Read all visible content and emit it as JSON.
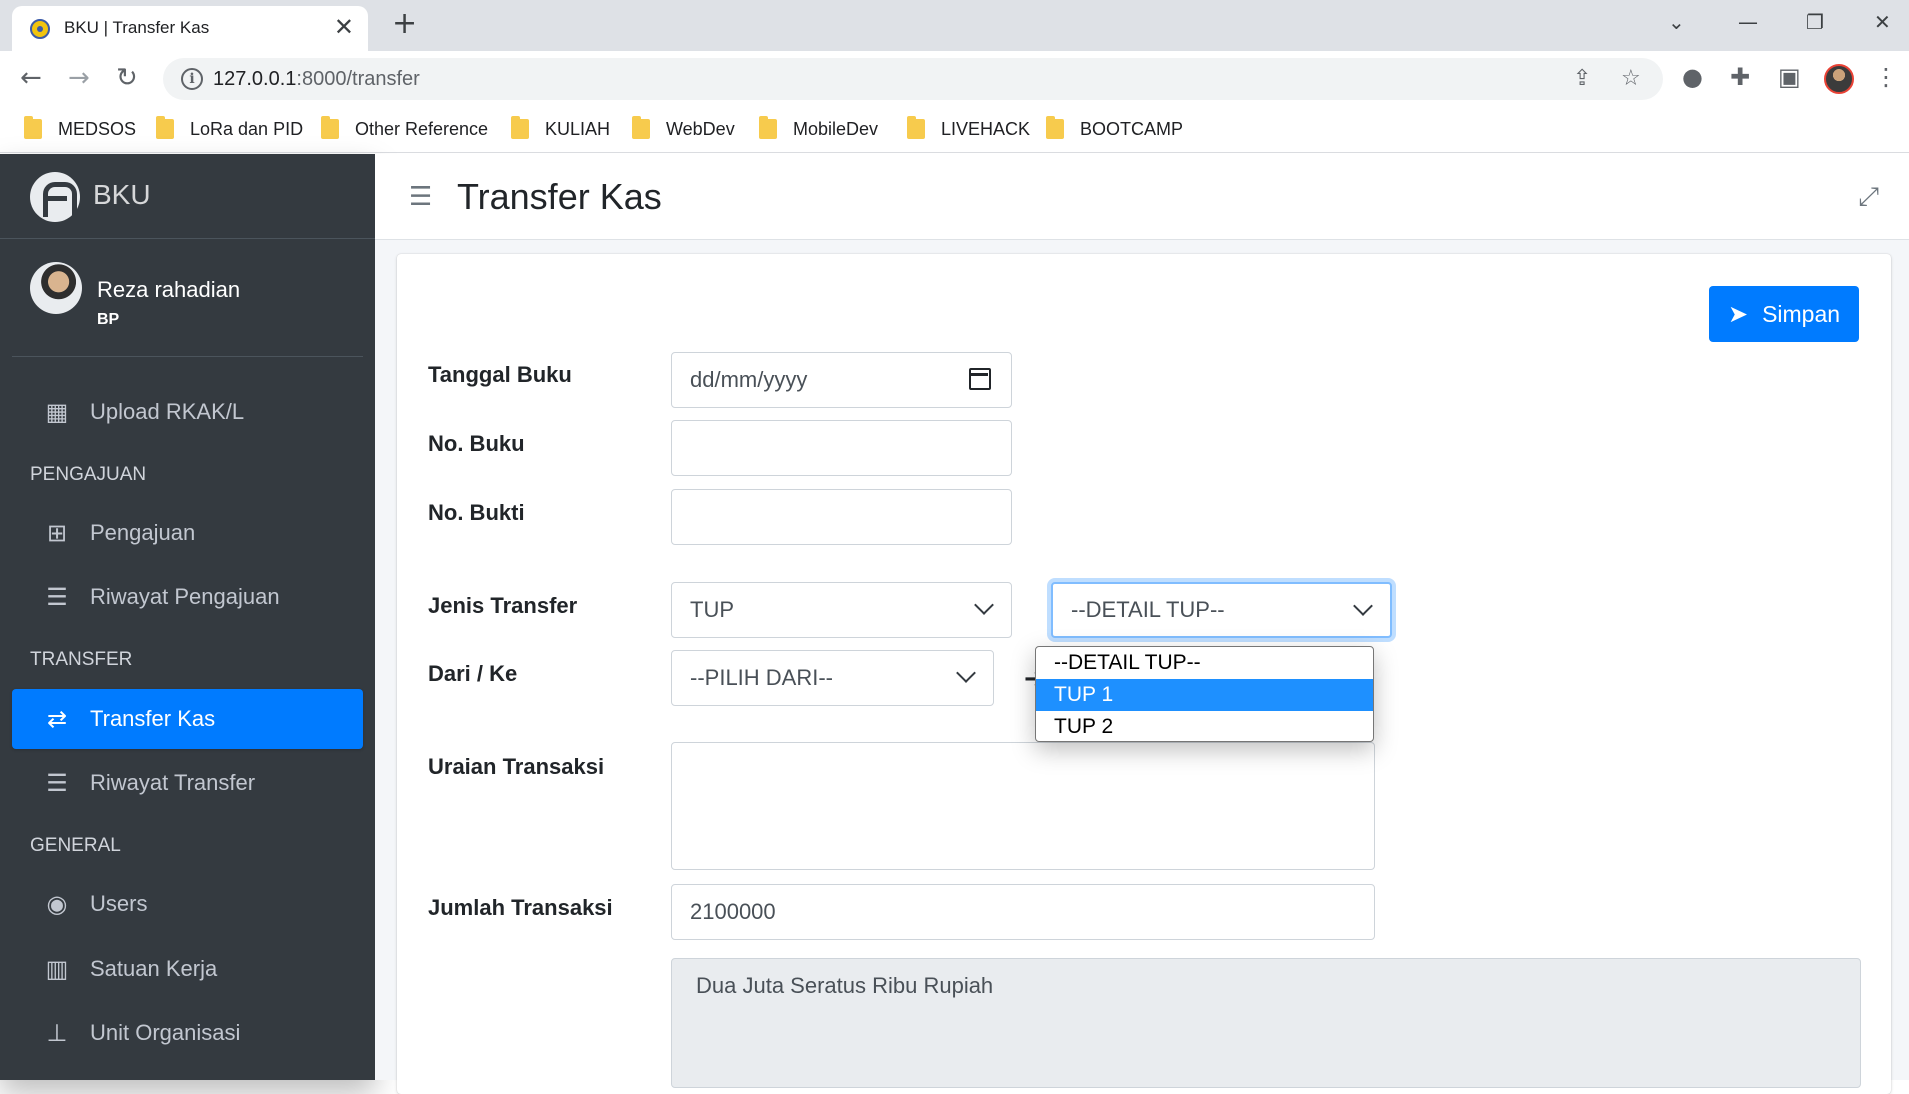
{
  "browser": {
    "tab_title": "BKU | Transfer Kas",
    "url_host": "127.0.0.1",
    "url_rest": ":8000/transfer",
    "bookmarks": [
      "MEDSOS",
      "LoRa dan PID",
      "Other Reference",
      "KULIAH",
      "WebDev",
      "MobileDev",
      "LIVEHACK",
      "BOOTCAMP"
    ]
  },
  "sidebar": {
    "brand": "BKU",
    "user_name": "Reza rahadian",
    "user_role": "BP",
    "items": [
      {
        "label": "Upload RKAK/L",
        "icon": "dashboard-icon"
      },
      {
        "header": "PENGAJUAN"
      },
      {
        "label": "Pengajuan",
        "icon": "plus-square-icon"
      },
      {
        "label": "Riwayat Pengajuan",
        "icon": "list-icon"
      },
      {
        "header": "TRANSFER"
      },
      {
        "label": "Transfer Kas",
        "icon": "exchange-icon",
        "active": true
      },
      {
        "label": "Riwayat Transfer",
        "icon": "list-icon"
      },
      {
        "header": "GENERAL"
      },
      {
        "label": "Users",
        "icon": "user-circle-icon"
      },
      {
        "label": "Satuan Kerja",
        "icon": "building-icon"
      },
      {
        "label": "Unit Organisasi",
        "icon": "sitemap-icon"
      }
    ]
  },
  "header": {
    "title": "Transfer Kas"
  },
  "form": {
    "save_label": "Simpan",
    "tanggal_label": "Tanggal Buku",
    "tanggal_placeholder": "dd/mm/yyyy",
    "nobuku_label": "No. Buku",
    "nobukti_label": "No. Bukti",
    "jenis_label": "Jenis Transfer",
    "jenis_value": "TUP",
    "detail_value": "--DETAIL TUP--",
    "darike_label": "Dari / Ke",
    "dari_value": "--PILIH DARI--",
    "uraian_label": "Uraian Transaksi",
    "jumlah_label": "Jumlah Transaksi",
    "jumlah_value": "2100000",
    "terbilang": "Dua Juta Seratus  Ribu  Rupiah"
  },
  "dropdown": {
    "options": [
      "--DETAIL TUP--",
      "TUP 1",
      "TUP 2"
    ],
    "highlighted": "TUP 1"
  },
  "colors": {
    "primary": "#007bff",
    "sidebar": "#343a40"
  }
}
